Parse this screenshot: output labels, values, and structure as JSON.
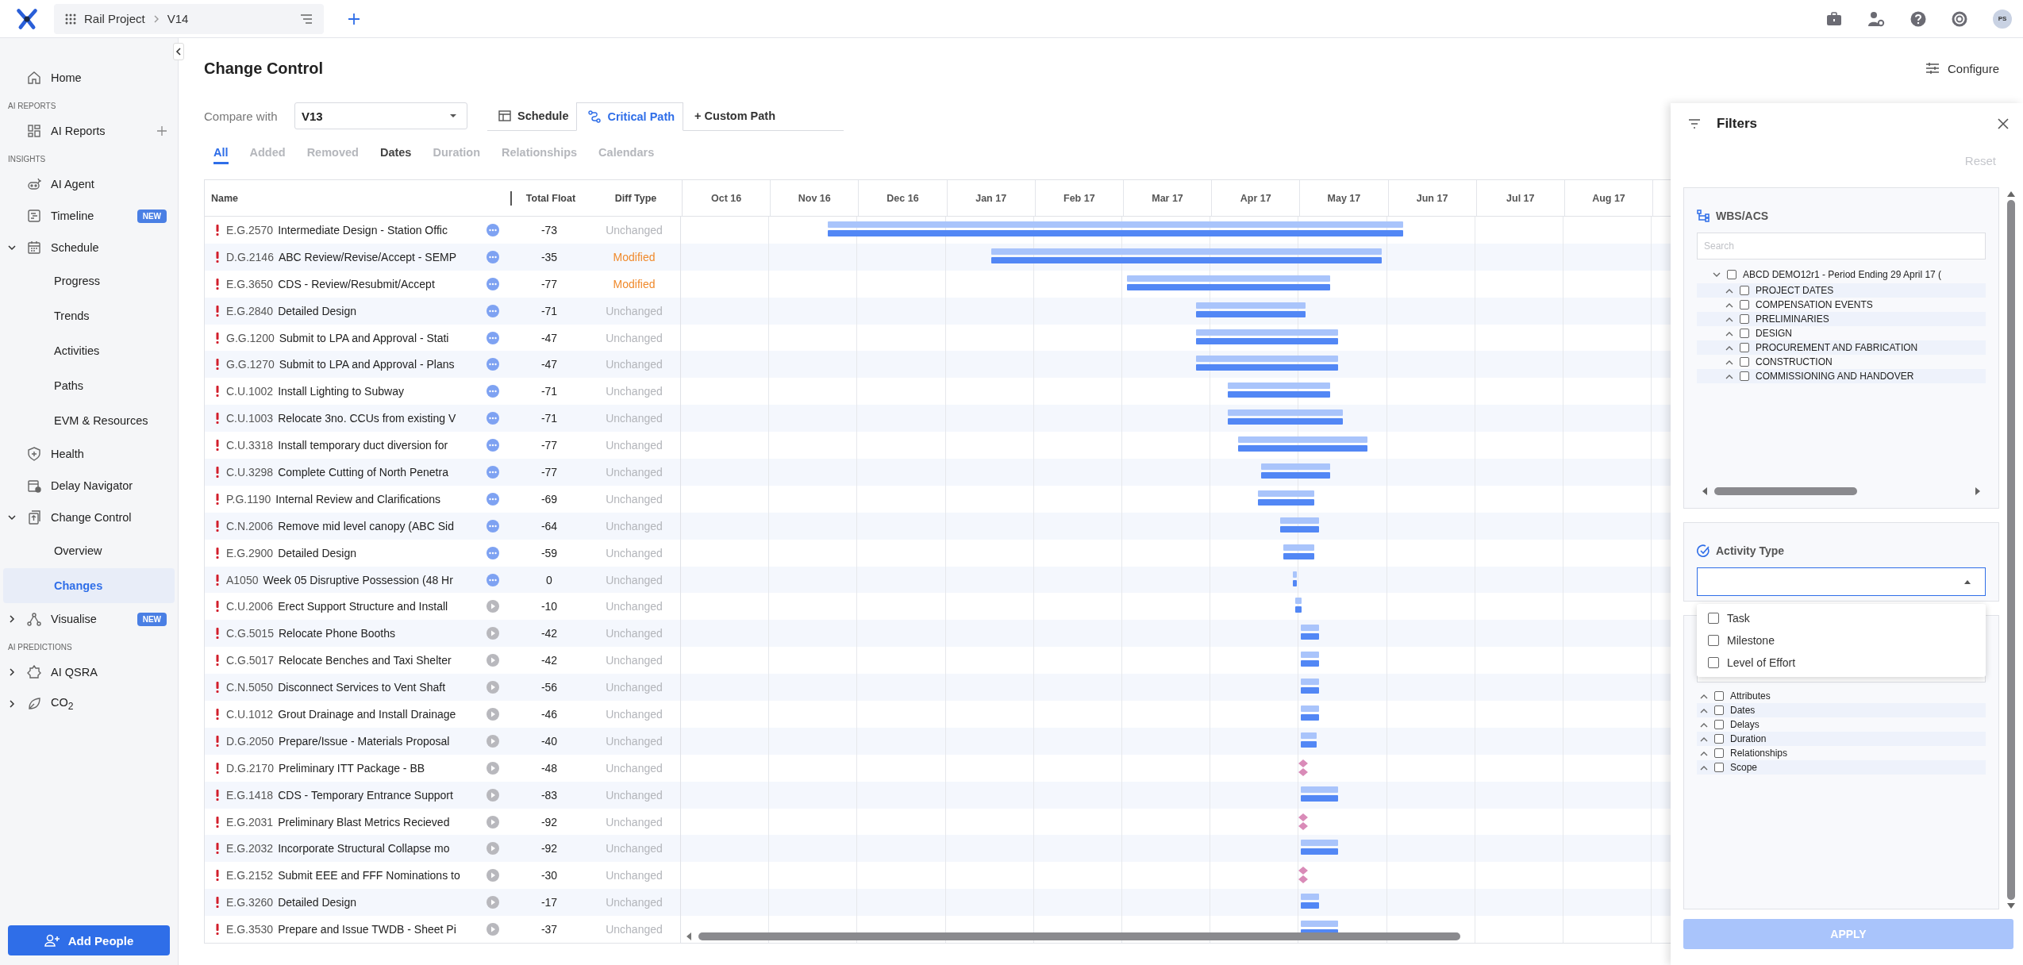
{
  "topbar": {
    "breadcrumb": [
      "Rail Project",
      "V14"
    ],
    "avatar": "PS"
  },
  "sidebar": {
    "sections": [
      {
        "items": [
          {
            "label": "Home",
            "selected": false
          }
        ]
      },
      {
        "heading": "AI REPORTS",
        "items": [
          {
            "label": "AI Reports",
            "selected": false
          }
        ]
      },
      {
        "heading": "INSIGHTS",
        "items": [
          {
            "label": "AI Agent",
            "selected": false
          },
          {
            "label": "Timeline",
            "badge": "NEW",
            "selected": false
          },
          {
            "label": "Schedule",
            "expanded": true,
            "selected": false,
            "children": [
              {
                "label": "Progress",
                "selected": false
              },
              {
                "label": "Trends",
                "selected": false
              },
              {
                "label": "Activities",
                "selected": false
              },
              {
                "label": "Paths",
                "selected": false
              },
              {
                "label": "EVM & Resources",
                "selected": false
              }
            ]
          },
          {
            "label": "Health",
            "selected": false
          },
          {
            "label": "Delay Navigator",
            "selected": false
          },
          {
            "label": "Change Control",
            "expanded": true,
            "selected": false,
            "children": [
              {
                "label": "Overview",
                "selected": false
              },
              {
                "label": "Changes",
                "selected": true
              }
            ]
          },
          {
            "label": "Visualise",
            "badge": "NEW",
            "expanded": false,
            "selected": false
          }
        ]
      },
      {
        "heading": "AI PREDICTIONS",
        "items": [
          {
            "label": "AI QSRA",
            "expanded": false,
            "selected": false
          },
          {
            "label": "CO$_{2}$",
            "expanded": false,
            "selected": false
          }
        ]
      }
    ],
    "button": "Add People"
  },
  "page": {
    "title": "Change Control",
    "configure": "Configure"
  },
  "compare": {
    "label": "Compare with",
    "value": "V13"
  },
  "view_tabs": [
    {
      "label": "Schedule",
      "selected": false
    },
    {
      "label": "Critical Path",
      "selected": true
    },
    {
      "label": "+ Custom Path",
      "selected": false
    }
  ],
  "diff_tabs": [
    {
      "label": "All",
      "selected": true,
      "disabled": false
    },
    {
      "label": "Added",
      "selected": false,
      "disabled": true
    },
    {
      "label": "Removed",
      "selected": false,
      "disabled": true
    },
    {
      "label": "Dates",
      "selected": false,
      "disabled": false
    },
    {
      "label": "Duration",
      "selected": false,
      "disabled": true
    },
    {
      "label": "Relationships",
      "selected": false,
      "disabled": true
    },
    {
      "label": "Calendars",
      "selected": false,
      "disabled": true
    }
  ],
  "table": {
    "columns": [
      "Name",
      "Total Float",
      "Diff Type"
    ],
    "months": [
      "Oct 16",
      "Nov 16",
      "Dec 16",
      "Jan 17",
      "Feb 17",
      "Mar 17",
      "Apr 17",
      "May 17",
      "Jun 17",
      "Jul 17",
      "Aug 17"
    ],
    "rows": [
      {
        "id": "E.G.2570",
        "name": "Intermediate Design - Station Offic",
        "kind": "dots",
        "float": "-73",
        "diff": "Unchanged",
        "changed": false
      },
      {
        "id": "D.G.2146",
        "name": "ABC Review/Revise/Accept - SEMP",
        "kind": "dots",
        "float": "-35",
        "diff": "Modified",
        "changed": true
      },
      {
        "id": "E.G.3650",
        "name": "CDS - Review/Resubmit/Accept",
        "kind": "dots",
        "float": "-77",
        "diff": "Modified",
        "changed": true
      },
      {
        "id": "E.G.2840",
        "name": "Detailed Design",
        "kind": "dots",
        "float": "-71",
        "diff": "Unchanged",
        "changed": false
      },
      {
        "id": "G.G.1200",
        "name": "Submit to LPA and Approval - Stati",
        "kind": "dots",
        "float": "-47",
        "diff": "Unchanged",
        "changed": false
      },
      {
        "id": "G.G.1270",
        "name": "Submit to LPA and Approval - Plans",
        "kind": "dots",
        "float": "-47",
        "diff": "Unchanged",
        "changed": false
      },
      {
        "id": "C.U.1002",
        "name": "Install Lighting to Subway",
        "kind": "dots",
        "float": "-71",
        "diff": "Unchanged",
        "changed": false
      },
      {
        "id": "C.U.1003",
        "name": "Relocate 3no. CCUs from existing V",
        "kind": "dots",
        "float": "-71",
        "diff": "Unchanged",
        "changed": false
      },
      {
        "id": "C.U.3318",
        "name": "Install temporary duct diversion for",
        "kind": "dots",
        "float": "-77",
        "diff": "Unchanged",
        "changed": false
      },
      {
        "id": "C.U.3298",
        "name": "Complete Cutting of North Penetra",
        "kind": "dots",
        "float": "-77",
        "diff": "Unchanged",
        "changed": false
      },
      {
        "id": "P.G.1190",
        "name": "Internal Review and Clarifications",
        "kind": "dots",
        "float": "-69",
        "diff": "Unchanged",
        "changed": false
      },
      {
        "id": "C.N.2006",
        "name": "Remove mid level canopy (ABC Sid",
        "kind": "dots",
        "float": "-64",
        "diff": "Unchanged",
        "changed": false
      },
      {
        "id": "E.G.2900",
        "name": "Detailed Design",
        "kind": "dots",
        "float": "-59",
        "diff": "Unchanged",
        "changed": false
      },
      {
        "id": "A1050",
        "name": "Week 05 Disruptive Possession (48 Hr",
        "kind": "dots",
        "float": "0",
        "diff": "Unchanged",
        "changed": false
      },
      {
        "id": "C.U.2006",
        "name": "Erect Support Structure and Install",
        "kind": "play",
        "float": "-10",
        "diff": "Unchanged",
        "changed": false
      },
      {
        "id": "C.G.5015",
        "name": "Relocate Phone Booths",
        "kind": "play",
        "float": "-42",
        "diff": "Unchanged",
        "changed": false
      },
      {
        "id": "C.G.5017",
        "name": "Relocate Benches and Taxi Shelter",
        "kind": "play",
        "float": "-42",
        "diff": "Unchanged",
        "changed": false
      },
      {
        "id": "C.N.5050",
        "name": "Disconnect Services to Vent Shaft",
        "kind": "play",
        "float": "-56",
        "diff": "Unchanged",
        "changed": false
      },
      {
        "id": "C.U.1012",
        "name": "Grout Drainage and Install Drainage",
        "kind": "play",
        "float": "-46",
        "diff": "Unchanged",
        "changed": false
      },
      {
        "id": "D.G.2050",
        "name": "Prepare/Issue - Materials Proposal",
        "kind": "play",
        "float": "-40",
        "diff": "Unchanged",
        "changed": false
      },
      {
        "id": "D.G.2170",
        "name": "Preliminary ITT Package - BB",
        "kind": "play",
        "float": "-48",
        "diff": "Unchanged",
        "changed": false
      },
      {
        "id": "E.G.1418",
        "name": "CDS - Temporary Entrance Support",
        "kind": "play",
        "float": "-83",
        "diff": "Unchanged",
        "changed": false
      },
      {
        "id": "E.G.2031",
        "name": "Preliminary Blast Metrics Recieved",
        "kind": "play",
        "float": "-92",
        "diff": "Unchanged",
        "changed": false
      },
      {
        "id": "E.G.2032",
        "name": "Incorporate Structural Collapse mo",
        "kind": "play",
        "float": "-92",
        "diff": "Unchanged",
        "changed": false
      },
      {
        "id": "E.G.2152",
        "name": "Submit EEE and FFF Nominations to",
        "kind": "play",
        "float": "-30",
        "diff": "Unchanged",
        "changed": false
      },
      {
        "id": "E.G.3260",
        "name": "Detailed Design",
        "kind": "play",
        "float": "-17",
        "diff": "Unchanged",
        "changed": false
      },
      {
        "id": "E.G.3530",
        "name": "Prepare and Issue TWDB - Sheet Pi",
        "kind": "play",
        "float": "-37",
        "diff": "Unchanged",
        "changed": false
      }
    ]
  },
  "filters": {
    "title": "Filters",
    "reset": "Reset",
    "wbs": {
      "title": "WBS/ACS",
      "placeholder": "Search",
      "tree": [
        {
          "label": "ABCD DEMO12r1 - Period Ending 29 April 17 (",
          "expanded": true,
          "checked": false,
          "children": [
            {
              "label": "PROJECT DATES",
              "expanded": false,
              "checked": false
            },
            {
              "label": "COMPENSATION EVENTS",
              "expanded": false,
              "checked": false
            },
            {
              "label": "PRELIMINARIES",
              "expanded": false,
              "checked": false
            },
            {
              "label": "DESIGN",
              "expanded": false,
              "checked": false
            },
            {
              "label": "PROCUREMENT AND FABRICATION",
              "expanded": false,
              "checked": false
            },
            {
              "label": "CONSTRUCTION",
              "expanded": false,
              "checked": false
            },
            {
              "label": "COMMISSIONING AND HANDOVER",
              "expanded": false,
              "checked": false
            }
          ]
        }
      ]
    },
    "activity": {
      "title": "Activity Type",
      "options": [
        {
          "label": "Task",
          "checked": false
        },
        {
          "label": "Milestone",
          "checked": false
        },
        {
          "label": "Level of Effort",
          "checked": false
        }
      ]
    },
    "other": {
      "items": [
        {
          "label": "Attributes",
          "expanded": false,
          "checked": false
        },
        {
          "label": "Dates",
          "expanded": false,
          "checked": false
        },
        {
          "label": "Delays",
          "expanded": false,
          "checked": false
        },
        {
          "label": "Duration",
          "expanded": false,
          "checked": false
        },
        {
          "label": "Relationships",
          "expanded": false,
          "checked": false
        },
        {
          "label": "Scope",
          "expanded": false,
          "checked": false
        }
      ]
    },
    "apply": "APPLY"
  }
}
